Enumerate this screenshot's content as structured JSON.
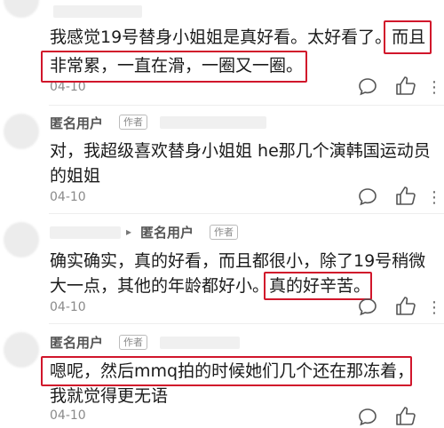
{
  "comments": [
    {
      "user": "",
      "text_lines": [
        "我感觉19号替身小姐姐是真好看。太好看了。而且",
        "非常累，一直在滑，一圈又一圈。"
      ],
      "date": "04-10"
    },
    {
      "user": "匿名用户",
      "author_tag": "作者",
      "text_lines": [
        "对，我超级喜欢替身小姐姐 he那几个演韩国运动员",
        "的姐姐"
      ],
      "date": "04-10"
    },
    {
      "user": "匿名用户",
      "author_tag": "作者",
      "reply_arrow": "▸",
      "text_lines": [
        "确实确实，真的好看，而且都很小，除了19号稍微",
        "大一点，其他的年龄都好小。真的好辛苦。"
      ],
      "date": "04-10"
    },
    {
      "user": "匿名用户",
      "author_tag": "作者",
      "text_lines": [
        "嗯呢，然后mmq拍的时候她们几个还在那冻着，",
        "我就觉得更无语"
      ],
      "date": "04-10"
    }
  ],
  "icons": {
    "comment": "comment-bubble-icon",
    "like": "thumbs-up-icon",
    "more": "more-dots-icon"
  },
  "colors": {
    "highlight": "#d1162b",
    "text": "#1b1b1b",
    "meta": "#8a8a8a"
  }
}
